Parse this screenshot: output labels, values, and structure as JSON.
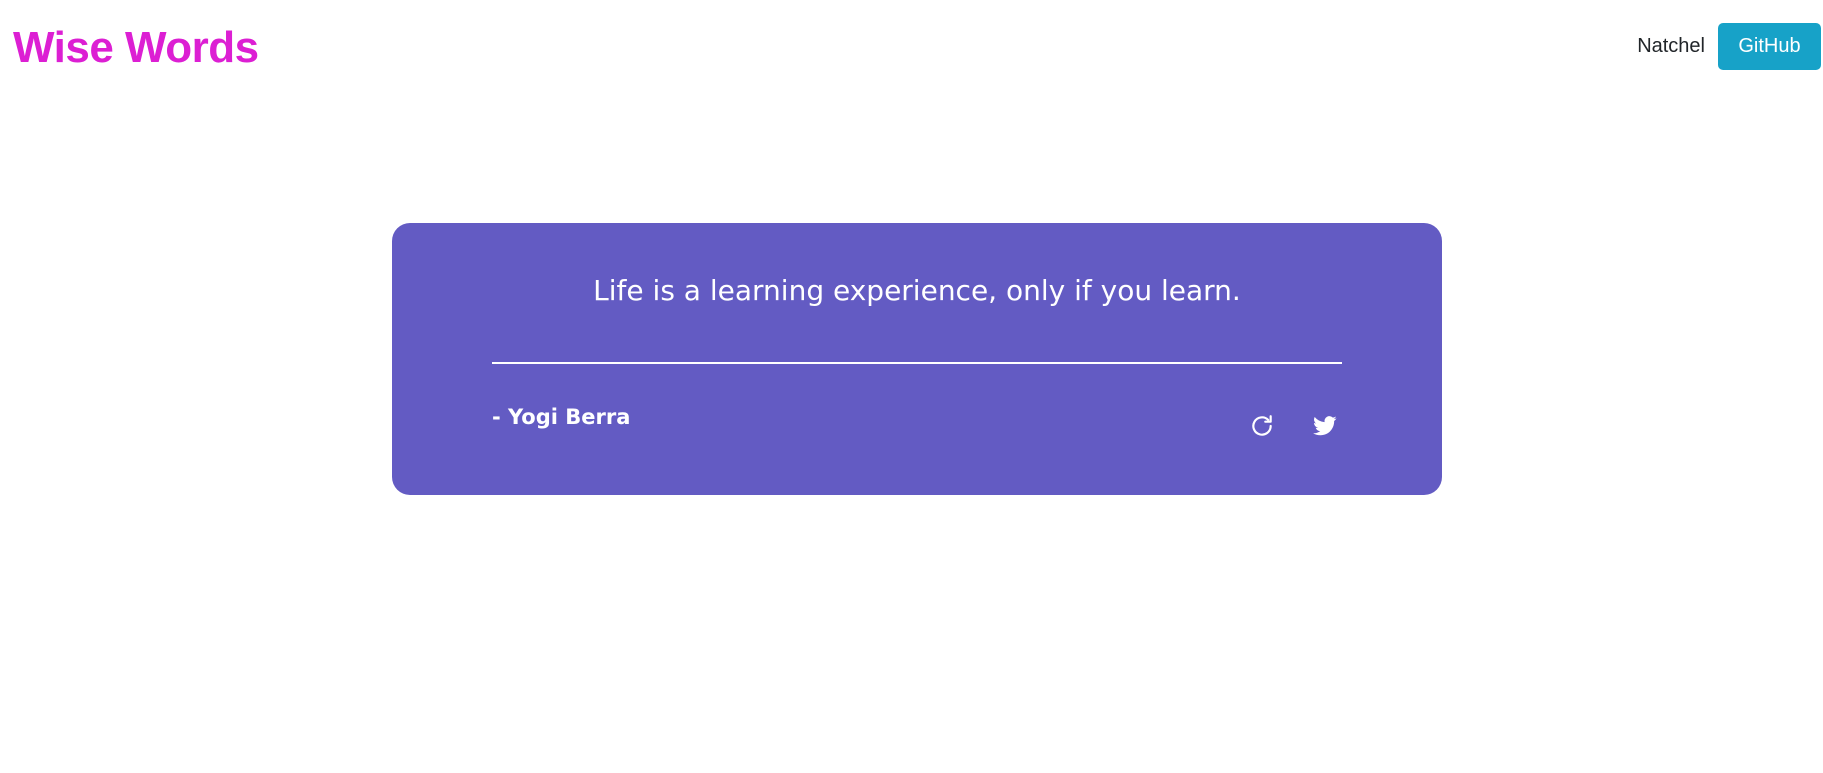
{
  "header": {
    "brand": "Wise Words",
    "author_link": "Natchel",
    "github_label": "GitHub"
  },
  "quote": {
    "text": "Life is a learning experience, only if you learn.",
    "author": "- Yogi Berra"
  },
  "actions": {
    "refresh_icon": "refresh-icon",
    "twitter_icon": "twitter-icon"
  },
  "colors": {
    "brand": "#dc1fd3",
    "github_button": "#17a2c8",
    "card_background": "#635bc3",
    "card_text": "#ffffff",
    "page_background": "#ffffff"
  }
}
